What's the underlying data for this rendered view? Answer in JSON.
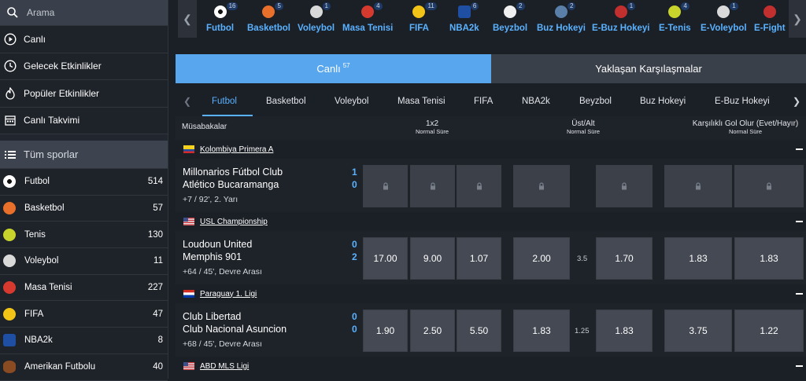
{
  "search": {
    "placeholder": "Arama"
  },
  "menu": [
    {
      "label": "Canlı",
      "icon": "play-circle-icon"
    },
    {
      "label": "Gelecek Etkinlikler",
      "icon": "clock-icon"
    },
    {
      "label": "Popüler Etkinlikler",
      "icon": "flame-icon"
    },
    {
      "label": "Canlı Takvimi",
      "icon": "calendar-icon"
    }
  ],
  "all_sports": {
    "label": "Tüm sporlar"
  },
  "sports": [
    {
      "name": "Futbol",
      "count": "514",
      "color": "#ffffff"
    },
    {
      "name": "Basketbol",
      "count": "57",
      "color": "#e8702a"
    },
    {
      "name": "Tenis",
      "count": "130",
      "color": "#c8d42b"
    },
    {
      "name": "Voleybol",
      "count": "11",
      "color": "#d9d9d9"
    },
    {
      "name": "Masa Tenisi",
      "count": "227",
      "color": "#d63a2f"
    },
    {
      "name": "FIFA",
      "count": "47",
      "color": "#f2c418"
    },
    {
      "name": "NBA2k",
      "count": "8",
      "color": "#1f4fa3"
    },
    {
      "name": "Amerikan Futbolu",
      "count": "40",
      "color": "#8a4a22"
    }
  ],
  "top_sports": [
    {
      "label": "Futbol",
      "badge": "16",
      "color": "#ffffff"
    },
    {
      "label": "Basketbol",
      "badge": "5",
      "color": "#e8702a"
    },
    {
      "label": "Voleybol",
      "badge": "1",
      "color": "#d9d9d9"
    },
    {
      "label": "Masa Tenisi",
      "badge": "4",
      "color": "#d63a2f"
    },
    {
      "label": "FIFA",
      "badge": "11",
      "color": "#f2c418"
    },
    {
      "label": "NBA2k",
      "badge": "6",
      "color": "#1f4fa3"
    },
    {
      "label": "Beyzbol",
      "badge": "2",
      "color": "#f0f0f0"
    },
    {
      "label": "Buz Hokeyi",
      "badge": "2",
      "color": "#5a7fa8"
    },
    {
      "label": "E-Buz Hokeyi",
      "badge": "1",
      "color": "#c22f2f"
    },
    {
      "label": "E-Tenis",
      "badge": "4",
      "color": "#c8d42b"
    },
    {
      "label": "E-Voleybol",
      "badge": "1",
      "color": "#d9d9d9"
    },
    {
      "label": "E-Fight",
      "badge": "",
      "color": "#c22f2f"
    }
  ],
  "mode_tabs": {
    "live_label": "Canlı",
    "live_count": "57",
    "upcoming_label": "Yaklaşan Karşılaşmalar"
  },
  "subtabs": [
    "Futbol",
    "Basketbol",
    "Voleybol",
    "Masa Tenisi",
    "FIFA",
    "NBA2k",
    "Beyzbol",
    "Buz Hokeyi",
    "E-Buz Hokeyi"
  ],
  "market_header": {
    "matches_label": "Müsabakalar",
    "col1_title": "1x2",
    "col1_sub": "Normal Süre",
    "col2_title": "Üst/Alt",
    "col2_sub": "Normal Süre",
    "col3_title": "Karşılıklı Gol Olur (Evet/Hayır)",
    "col3_sub": "Normal Süre"
  },
  "leagues": [
    {
      "name": "Kolombiya Primera A",
      "match": {
        "home": "Millonarios Fútbol Club",
        "away": "Atlético Bucaramanga",
        "home_score": "1",
        "away_score": "0",
        "status": "+7 / 92', 2. Yarı",
        "locked": true,
        "odds": [
          "",
          "",
          "",
          "",
          "",
          "",
          ""
        ],
        "line": ""
      }
    },
    {
      "name": "USL Championship",
      "match": {
        "home": "Loudoun United",
        "away": "Memphis 901",
        "home_score": "0",
        "away_score": "2",
        "status": "+64 / 45', Devre Arası",
        "locked": false,
        "odds": [
          "17.00",
          "9.00",
          "1.07",
          "2.00",
          "1.70",
          "1.83",
          "1.83"
        ],
        "line": "3.5"
      }
    },
    {
      "name": "Paraguay 1. Ligi",
      "match": {
        "home": "Club Libertad",
        "away": "Club Nacional Asuncion",
        "home_score": "0",
        "away_score": "0",
        "status": "+68 / 45', Devre Arası",
        "locked": false,
        "odds": [
          "1.90",
          "2.50",
          "5.50",
          "1.83",
          "1.83",
          "3.75",
          "1.22"
        ],
        "line": "1.25"
      }
    },
    {
      "name": "ABD MLS Ligi"
    }
  ]
}
